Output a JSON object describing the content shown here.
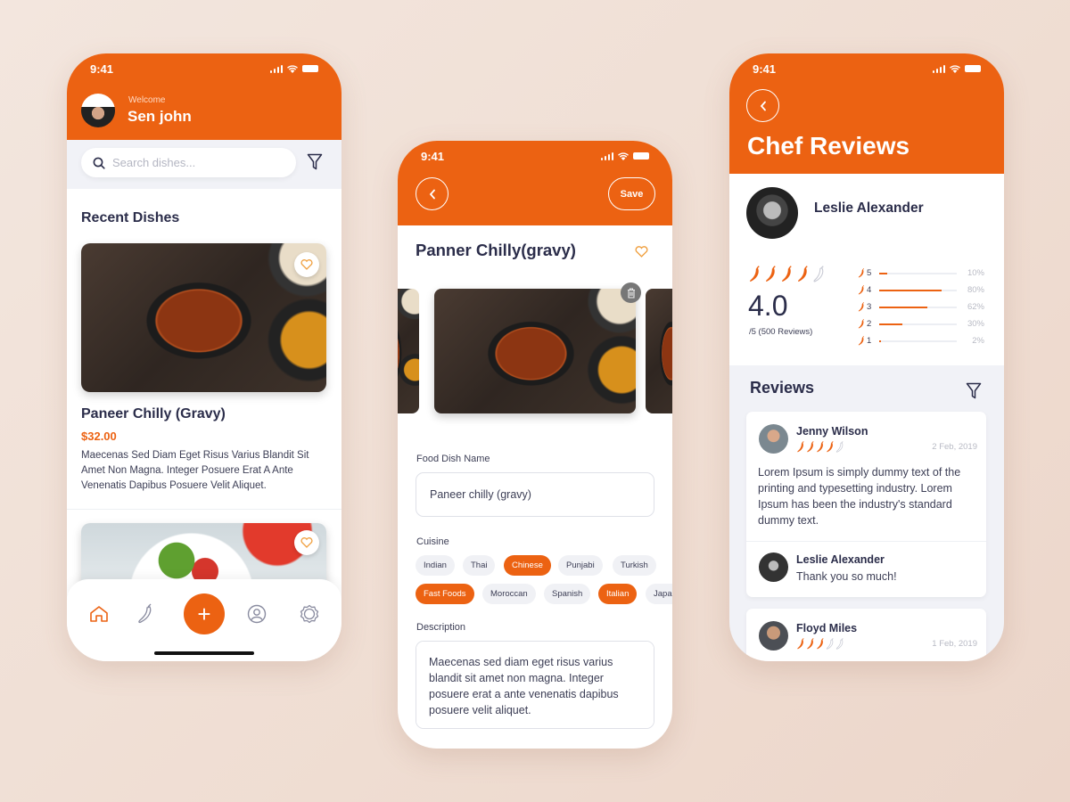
{
  "colors": {
    "accent": "#ec6212",
    "text_dark": "#2b2d4a",
    "muted": "#b8bac4"
  },
  "phone_home": {
    "status_time": "9:41",
    "welcome_label": "Welcome",
    "user_name": "Sen john",
    "search_placeholder": "Search dishes...",
    "section_title": "Recent Dishes",
    "dishes": [
      {
        "title": "Paneer Chilly (Gravy)",
        "price": "$32.00",
        "description": "Maecenas Sed Diam Eget Risus Varius Blandit Sit Amet Non Magna. Integer Posuere Erat A Ante Venenatis Dapibus Posuere Velit Aliquet.",
        "image": "curry-dish"
      },
      {
        "title": "",
        "image": "salad-dish"
      }
    ],
    "nav": [
      {
        "name": "home",
        "icon": "home-icon",
        "active": true
      },
      {
        "name": "dishes",
        "icon": "chili-icon"
      },
      {
        "name": "add",
        "icon": "plus-icon",
        "label": "+"
      },
      {
        "name": "profile",
        "icon": "user-icon"
      },
      {
        "name": "settings",
        "icon": "gear-icon"
      }
    ]
  },
  "phone_edit": {
    "status_time": "9:41",
    "save_label": "Save",
    "title": "Panner Chilly(gravy)",
    "name_label": "Food Dish Name",
    "name_value": "Paneer chilly (gravy)",
    "cuisine_label": "Cuisine",
    "cuisines": [
      {
        "label": "Indian",
        "selected": false
      },
      {
        "label": "Thai",
        "selected": false
      },
      {
        "label": "Chinese",
        "selected": true
      },
      {
        "label": "Punjabi",
        "selected": false
      },
      {
        "label": "Turkish",
        "selected": false
      },
      {
        "label": "Fast Foods",
        "selected": true
      },
      {
        "label": "Moroccan",
        "selected": false
      },
      {
        "label": "Spanish",
        "selected": false
      },
      {
        "label": "Italian",
        "selected": true
      },
      {
        "label": "Japanese",
        "selected": false
      }
    ],
    "description_label": "Description",
    "description_value": "Maecenas sed diam eget risus varius blandit sit amet non magna. Integer posuere erat a ante venenatis dapibus posuere velit aliquet."
  },
  "phone_reviews": {
    "status_time": "9:41",
    "title": "Chef Reviews",
    "chef_name": "Leslie Alexander",
    "rating": "4.0",
    "rating_chilis": 4,
    "rating_sub": "/5 (500 Reviews)",
    "breakdown": [
      {
        "level": "5",
        "percent": 10,
        "label": "10%"
      },
      {
        "level": "4",
        "percent": 80,
        "label": "80%"
      },
      {
        "level": "3",
        "percent": 62,
        "label": "62%"
      },
      {
        "level": "2",
        "percent": 30,
        "label": "30%"
      },
      {
        "level": "1",
        "percent": 2,
        "label": "2%"
      }
    ],
    "reviews_title": "Reviews",
    "reviews": [
      {
        "name": "Jenny Wilson",
        "chilis": 4,
        "date": "2 Feb, 2019",
        "text": "Lorem Ipsum is simply dummy text of the printing and typesetting industry. Lorem Ipsum has been the industry's standard dummy text.",
        "reply": {
          "name": "Leslie Alexander",
          "text": "Thank you so much!"
        }
      },
      {
        "name": "Floyd Miles",
        "chilis": 3,
        "date": "1 Feb, 2019"
      }
    ]
  }
}
